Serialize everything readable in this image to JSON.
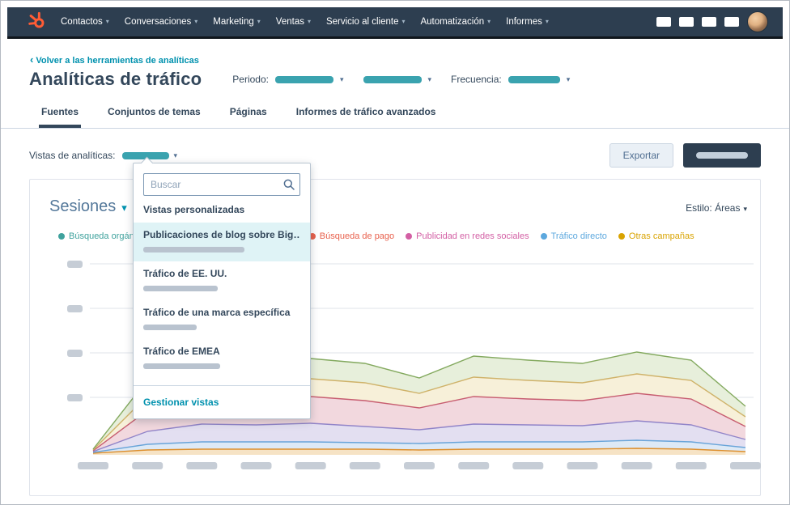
{
  "icons": {
    "chevron_down": "▾",
    "chevron_left": "‹"
  },
  "nav": {
    "items": [
      {
        "label": "Contactos"
      },
      {
        "label": "Conversaciones"
      },
      {
        "label": "Marketing"
      },
      {
        "label": "Ventas"
      },
      {
        "label": "Servicio al cliente"
      },
      {
        "label": "Automatización"
      },
      {
        "label": "Informes"
      }
    ]
  },
  "header": {
    "back_link": "Volver a las herramientas de analíticas",
    "title": "Analíticas de tráfico",
    "period_label": "Periodo:",
    "frequency_label": "Frecuencia:"
  },
  "tabs": {
    "items": [
      {
        "label": "Fuentes",
        "active": true
      },
      {
        "label": "Conjuntos de temas",
        "active": false
      },
      {
        "label": "Páginas",
        "active": false
      },
      {
        "label": "Informes de tráfico avanzados",
        "active": false
      }
    ]
  },
  "toolbar": {
    "views_label": "Vistas de analíticas:",
    "export_label": "Exportar"
  },
  "dropdown": {
    "search_placeholder": "Buscar",
    "section_label": "Vistas personalizadas",
    "items": [
      {
        "title": "Publicaciones de blog sobre Big…",
        "selected": true
      },
      {
        "title": "Tráfico de EE. UU.",
        "selected": false
      },
      {
        "title": "Tráfico de una marca específica",
        "selected": false
      },
      {
        "title": "Tráfico de EMEA",
        "selected": false
      }
    ],
    "manage_label": "Gestionar vistas"
  },
  "report": {
    "title": "Sesiones",
    "style_label": "Estilo:",
    "style_value": "Áreas"
  },
  "legend": {
    "items": [
      {
        "label": "Búsqueda orgánica",
        "color": "#3fa29d"
      },
      {
        "label": "Búsqueda de pago",
        "color": "#e8604c"
      },
      {
        "label": "Publicidad en redes sociales",
        "color": "#d35fa4"
      },
      {
        "label": "Tráfico directo",
        "color": "#5ca8de"
      },
      {
        "label": "Otras campañas",
        "color": "#d9a300"
      }
    ]
  },
  "colors": {
    "navbar": "#2d3e50",
    "accent_teal": "#0091ae",
    "title_navy": "#33475b",
    "logo_orange": "#ff5c35",
    "redaction_teal": "#3aa3af",
    "redaction_gray": "#b9c3cf",
    "selected_item_bg": "#dff3f6"
  },
  "chart_data": {
    "type": "area",
    "stacked": true,
    "title": "Sesiones",
    "style": "Áreas",
    "legend_position": "top",
    "grid": true,
    "xlabel": "",
    "ylabel": "",
    "x_tick_labels": "redacted",
    "y_tick_labels": "redacted",
    "x": [
      1,
      2,
      3,
      4,
      5,
      6,
      7,
      8,
      9,
      10,
      11,
      12,
      13
    ],
    "series_order": "bottom-to-top",
    "series": [
      {
        "name": "Otras campañas",
        "color": "#dd8f2d",
        "fill": "#f6e3c5",
        "values": [
          2,
          6,
          7,
          7,
          7,
          7,
          6,
          7,
          7,
          7,
          8,
          7,
          4
        ]
      },
      {
        "name": "Tráfico directo",
        "color": "#68a4d9",
        "fill": "#dde9f6",
        "values": [
          1,
          7,
          9,
          9,
          9,
          8,
          8,
          9,
          9,
          9,
          10,
          9,
          5
        ]
      },
      {
        "name": "Publicidad en redes sociales",
        "color": "#9184c8",
        "fill": "#e3dff1",
        "values": [
          1,
          16,
          22,
          21,
          23,
          20,
          17,
          22,
          21,
          20,
          24,
          21,
          10
        ]
      },
      {
        "name": "Búsqueda de pago",
        "color": "#c75d70",
        "fill": "#f2d8de",
        "values": [
          1,
          26,
          32,
          31,
          33,
          32,
          27,
          34,
          32,
          31,
          34,
          32,
          16
        ]
      },
      {
        "name": "",
        "color": "#cfb269",
        "fill": "#f7f0d9",
        "values": [
          1,
          18,
          22,
          22,
          22,
          22,
          18,
          24,
          23,
          22,
          24,
          23,
          12
        ]
      },
      {
        "name": "Búsqueda orgánica",
        "color": "#83a95e",
        "fill": "#e7efdb",
        "values": [
          1,
          20,
          24,
          24,
          25,
          24,
          19,
          26,
          25,
          24,
          27,
          25,
          13
        ]
      }
    ]
  }
}
